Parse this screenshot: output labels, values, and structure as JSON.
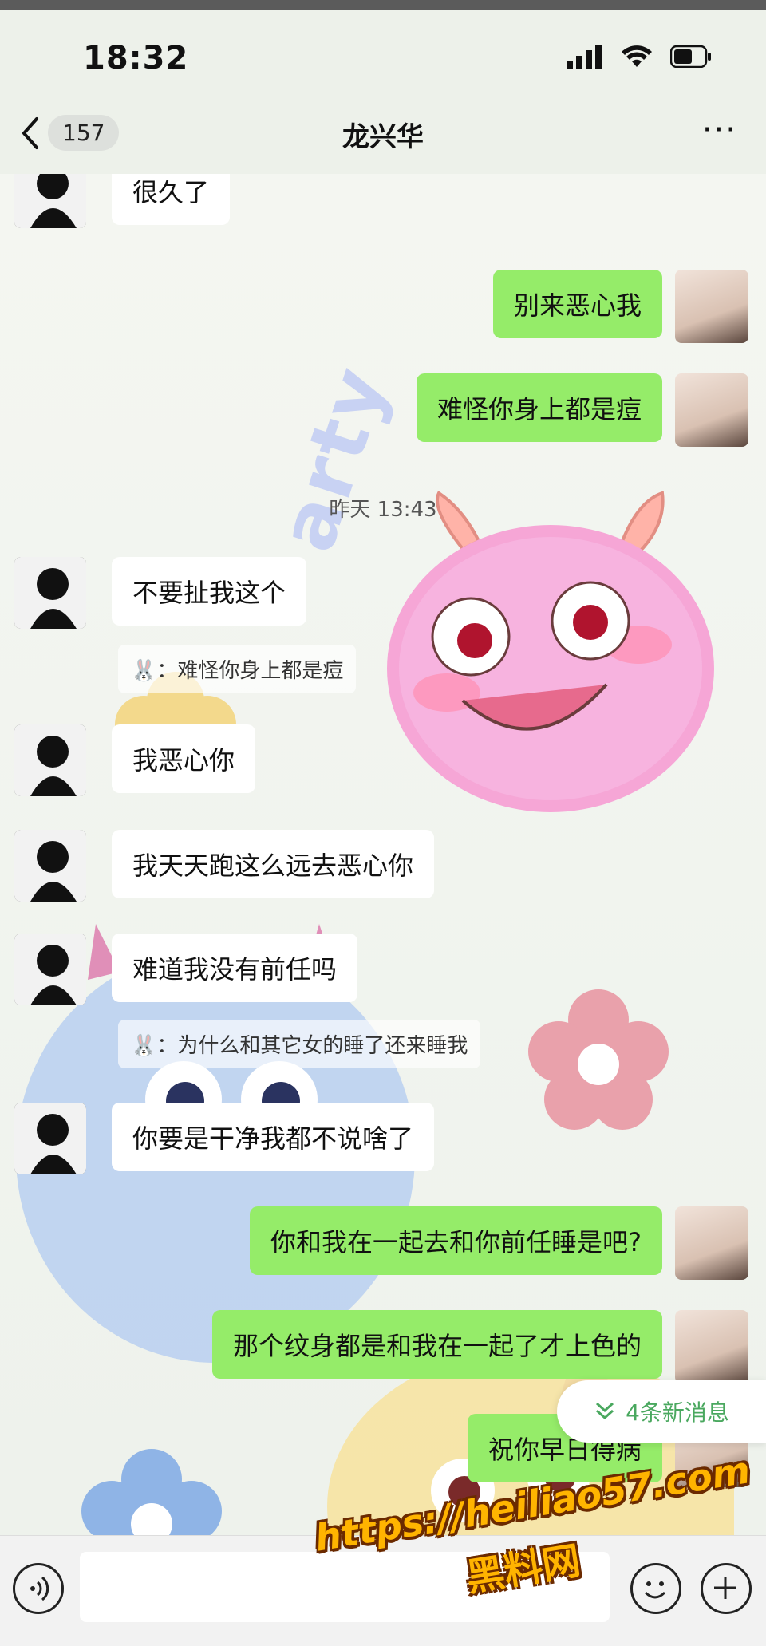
{
  "status_bar": {
    "time": "18:32"
  },
  "header": {
    "back_count": "157",
    "title": "龙兴华",
    "more": "···"
  },
  "messages": [
    {
      "side": "left",
      "text": "很久了"
    },
    {
      "side": "right",
      "text": "别来恶心我"
    },
    {
      "side": "right",
      "text": "难怪你身上都是痘"
    },
    {
      "side": "left",
      "text": "不要扯我这个"
    },
    {
      "side": "left",
      "text": "我恶心你"
    },
    {
      "side": "left",
      "text": "我天天跑这么远去恶心你"
    },
    {
      "side": "left",
      "text": "难道我没有前任吗"
    },
    {
      "side": "left",
      "text": "你要是干净我都不说啥了"
    },
    {
      "side": "right",
      "text": "你和我在一起去和你前任睡是吧?"
    },
    {
      "side": "right",
      "text": "那个纹身都是和我在一起了才上色的"
    },
    {
      "side": "right",
      "text": "祝你早日得病"
    }
  ],
  "timestamp": "昨天 13:43",
  "quotes": [
    {
      "prefix": "🐰：",
      "text": "难怪你身上都是痘"
    },
    {
      "prefix": "🐰：",
      "text": "为什么和其它女的睡了还来睡我"
    }
  ],
  "new_messages": "4条新消息",
  "background_text": "arty",
  "watermark": {
    "url": "https://heiliao57.com",
    "name": "黑料网"
  },
  "colors": {
    "bubble_green": "#95ec69",
    "bubble_white": "#ffffff",
    "new_msg_accent": "#4aa85f"
  }
}
